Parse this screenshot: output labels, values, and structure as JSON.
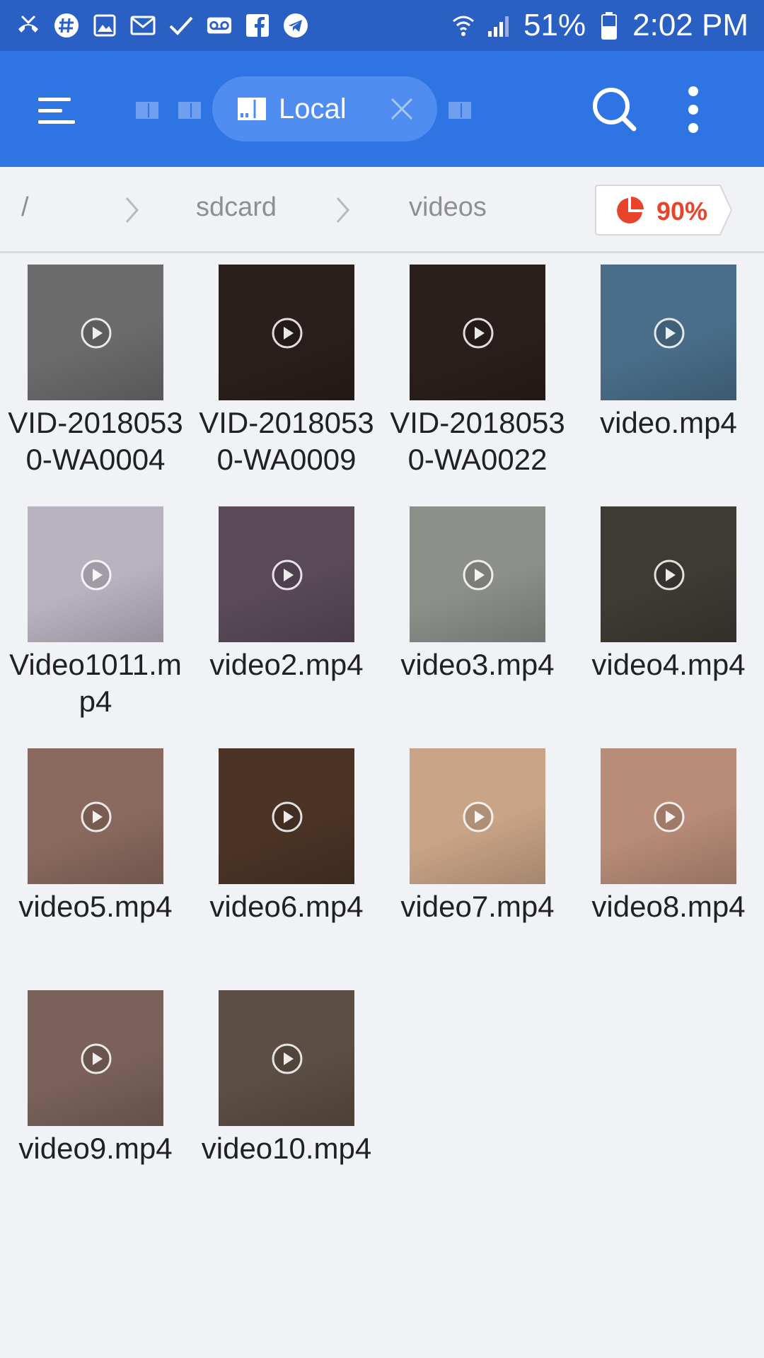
{
  "status_bar": {
    "battery": "51%",
    "time": "2:02 PM",
    "left_icons": [
      "missed-call-icon",
      "hashtag-icon",
      "gallery-icon",
      "gmail-icon",
      "check-icon",
      "voicemail-icon",
      "facebook-icon",
      "telegram-icon"
    ],
    "right_icons": [
      "wifi-icon",
      "signal-icon",
      "battery-icon"
    ]
  },
  "app_bar": {
    "active_tab_label": "Local",
    "tab_icon": "storage-card-icon"
  },
  "path": {
    "root": "/",
    "crumbs": [
      "sdcard",
      "videos"
    ],
    "storage_percent": "90%"
  },
  "files": [
    {
      "name": "VID-20180530-WA0004",
      "thumb": "#6b6b6b"
    },
    {
      "name": "VID-20180530-WA0009",
      "thumb": "#2a1f1c"
    },
    {
      "name": "VID-20180530-WA0022",
      "thumb": "#2a1f1c"
    },
    {
      "name": "video.mp4",
      "thumb": "#4a6e8a"
    },
    {
      "name": "Video1011.mp4",
      "thumb": "#b9b2c0"
    },
    {
      "name": "video2.mp4",
      "thumb": "#5a4a58"
    },
    {
      "name": "video3.mp4",
      "thumb": "#8c8f8a"
    },
    {
      "name": "video4.mp4",
      "thumb": "#3e3a34"
    },
    {
      "name": "video5.mp4",
      "thumb": "#8a6a5e"
    },
    {
      "name": "video6.mp4",
      "thumb": "#4b3426"
    },
    {
      "name": "video7.mp4",
      "thumb": "#c9a487"
    },
    {
      "name": "video8.mp4",
      "thumb": "#b78c78"
    },
    {
      "name": "video9.mp4",
      "thumb": "#7a625a"
    },
    {
      "name": "video10.mp4",
      "thumb": "#5c4e44"
    }
  ],
  "colors": {
    "status_bar": "#2a5fc4",
    "app_bar": "#2f74e3",
    "accent_red": "#e8432b"
  }
}
